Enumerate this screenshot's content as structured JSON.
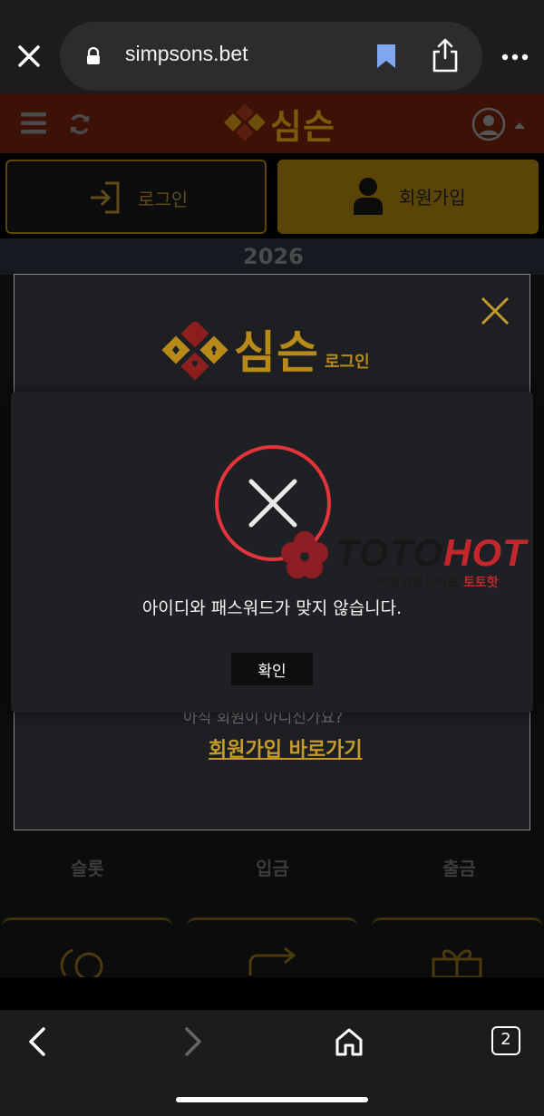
{
  "browser": {
    "url": "simpsons.bet",
    "icons": [
      "close-icon",
      "lock-icon",
      "bookmark-icon",
      "share-icon",
      "more-icon"
    ]
  },
  "site_header": {
    "logo_text": "심슨",
    "icons": [
      "menu-icon",
      "refresh-icon",
      "profile-icon"
    ]
  },
  "auth_buttons": {
    "login_label": "로그인",
    "join_label": "회원가입"
  },
  "banner": {
    "year": "2026"
  },
  "login_modal": {
    "logo_text": "심슨",
    "logo_sub": "로그인",
    "question": "아직 회원이 아니신가요?",
    "join_link": "회원가입 바로가기"
  },
  "alert": {
    "message": "아이디와 패스워드가 맞지 않습니다.",
    "ok_label": "확인"
  },
  "menu": {
    "items": [
      {
        "label": "슬롯"
      },
      {
        "label": "입금"
      },
      {
        "label": "출금"
      }
    ]
  },
  "watermark": {
    "brand_a": "TOTO",
    "brand_b": "HOT",
    "sub_a": "먹튀검증사이트 ",
    "sub_b": "토토핫"
  },
  "bottom_bar": {
    "tab_count": "2",
    "icons": [
      "back-icon",
      "forward-icon",
      "home-icon",
      "tabs-icon"
    ]
  },
  "colors": {
    "gold": "#c49b2a",
    "header_bg": "#3d1206",
    "alert_red": "#e5343c",
    "watermark_red": "#c4262c"
  }
}
